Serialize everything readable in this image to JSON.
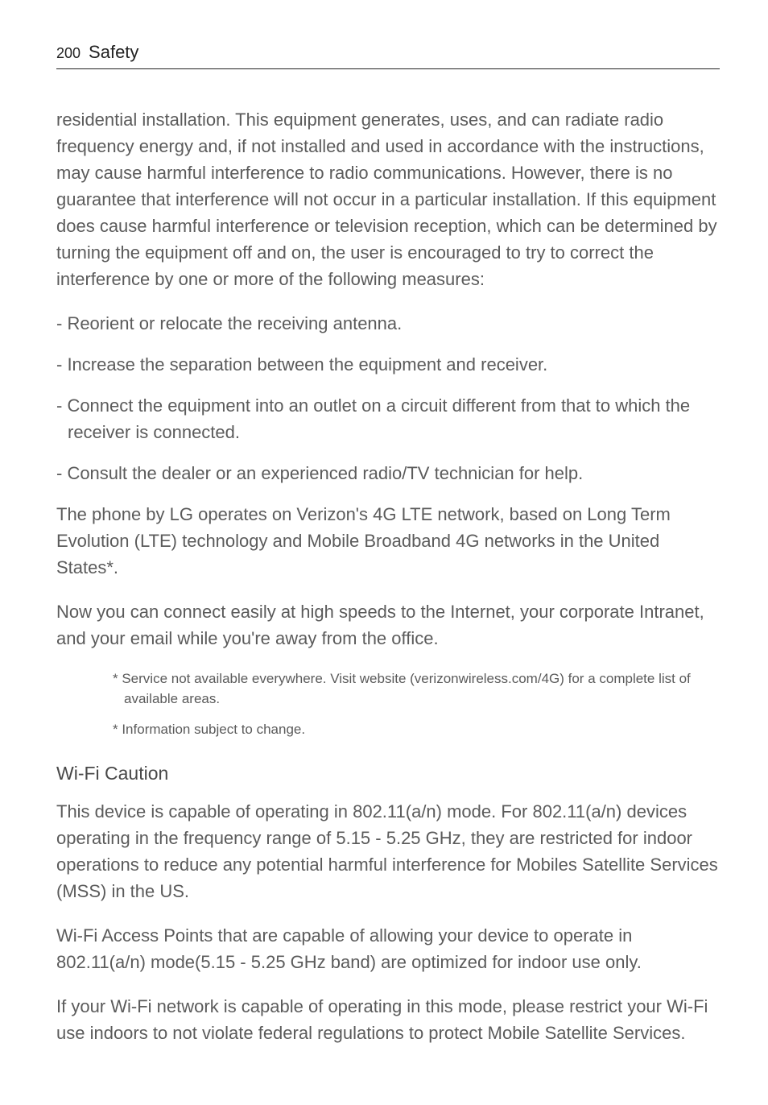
{
  "header": {
    "page_number": "200",
    "section": "Safety"
  },
  "body": {
    "intro": "residential installation. This equipment generates, uses, and can radiate radio frequency energy and, if not installed and used in accordance with the instructions, may cause harmful interference to radio communications. However, there is no guarantee that interference will not occur in a particular installation. If this equipment does cause harmful interference or television reception, which can be determined by turning the equipment off and on,  the user is encouraged to try to correct the interference by one or more of the following measures:",
    "measures": [
      "- Reorient or relocate the receiving antenna.",
      "- Increase the separation between the equipment and receiver.",
      "- Connect the equipment into an outlet on a circuit different from that to which the receiver is connected.",
      "- Consult the dealer or an experienced radio/TV technician for help."
    ],
    "lte_para": "The phone by LG operates on Verizon's 4G LTE network, based on Long Term Evolution (LTE) technology and Mobile Broadband 4G networks in the United States*.",
    "connect_para": "Now you can connect easily at high speeds to the Internet, your corporate Intranet, and your email while you're away from the office.",
    "footnotes": [
      "* Service not available everywhere. Visit website (verizonwireless.com/4G) for a complete list of available areas.",
      "* Information subject to change."
    ],
    "wifi_heading": "Wi-Fi Caution",
    "wifi_p1": "This device is capable of operating in 802.11(a/n) mode. For 802.11(a/n) devices operating in the frequency range of 5.15 - 5.25 GHz, they are restricted for indoor operations to reduce any potential harmful interference for Mobiles Satellite Services (MSS) in the US.",
    "wifi_p2": "Wi-Fi Access Points that are capable of allowing your device to operate in 802.11(a/n) mode(5.15 - 5.25 GHz band) are optimized for indoor use only.",
    "wifi_p3": "If your Wi-Fi network is capable of operating in this mode, please restrict your Wi-Fi use indoors to not violate federal regulations to protect Mobile Satellite Services."
  }
}
